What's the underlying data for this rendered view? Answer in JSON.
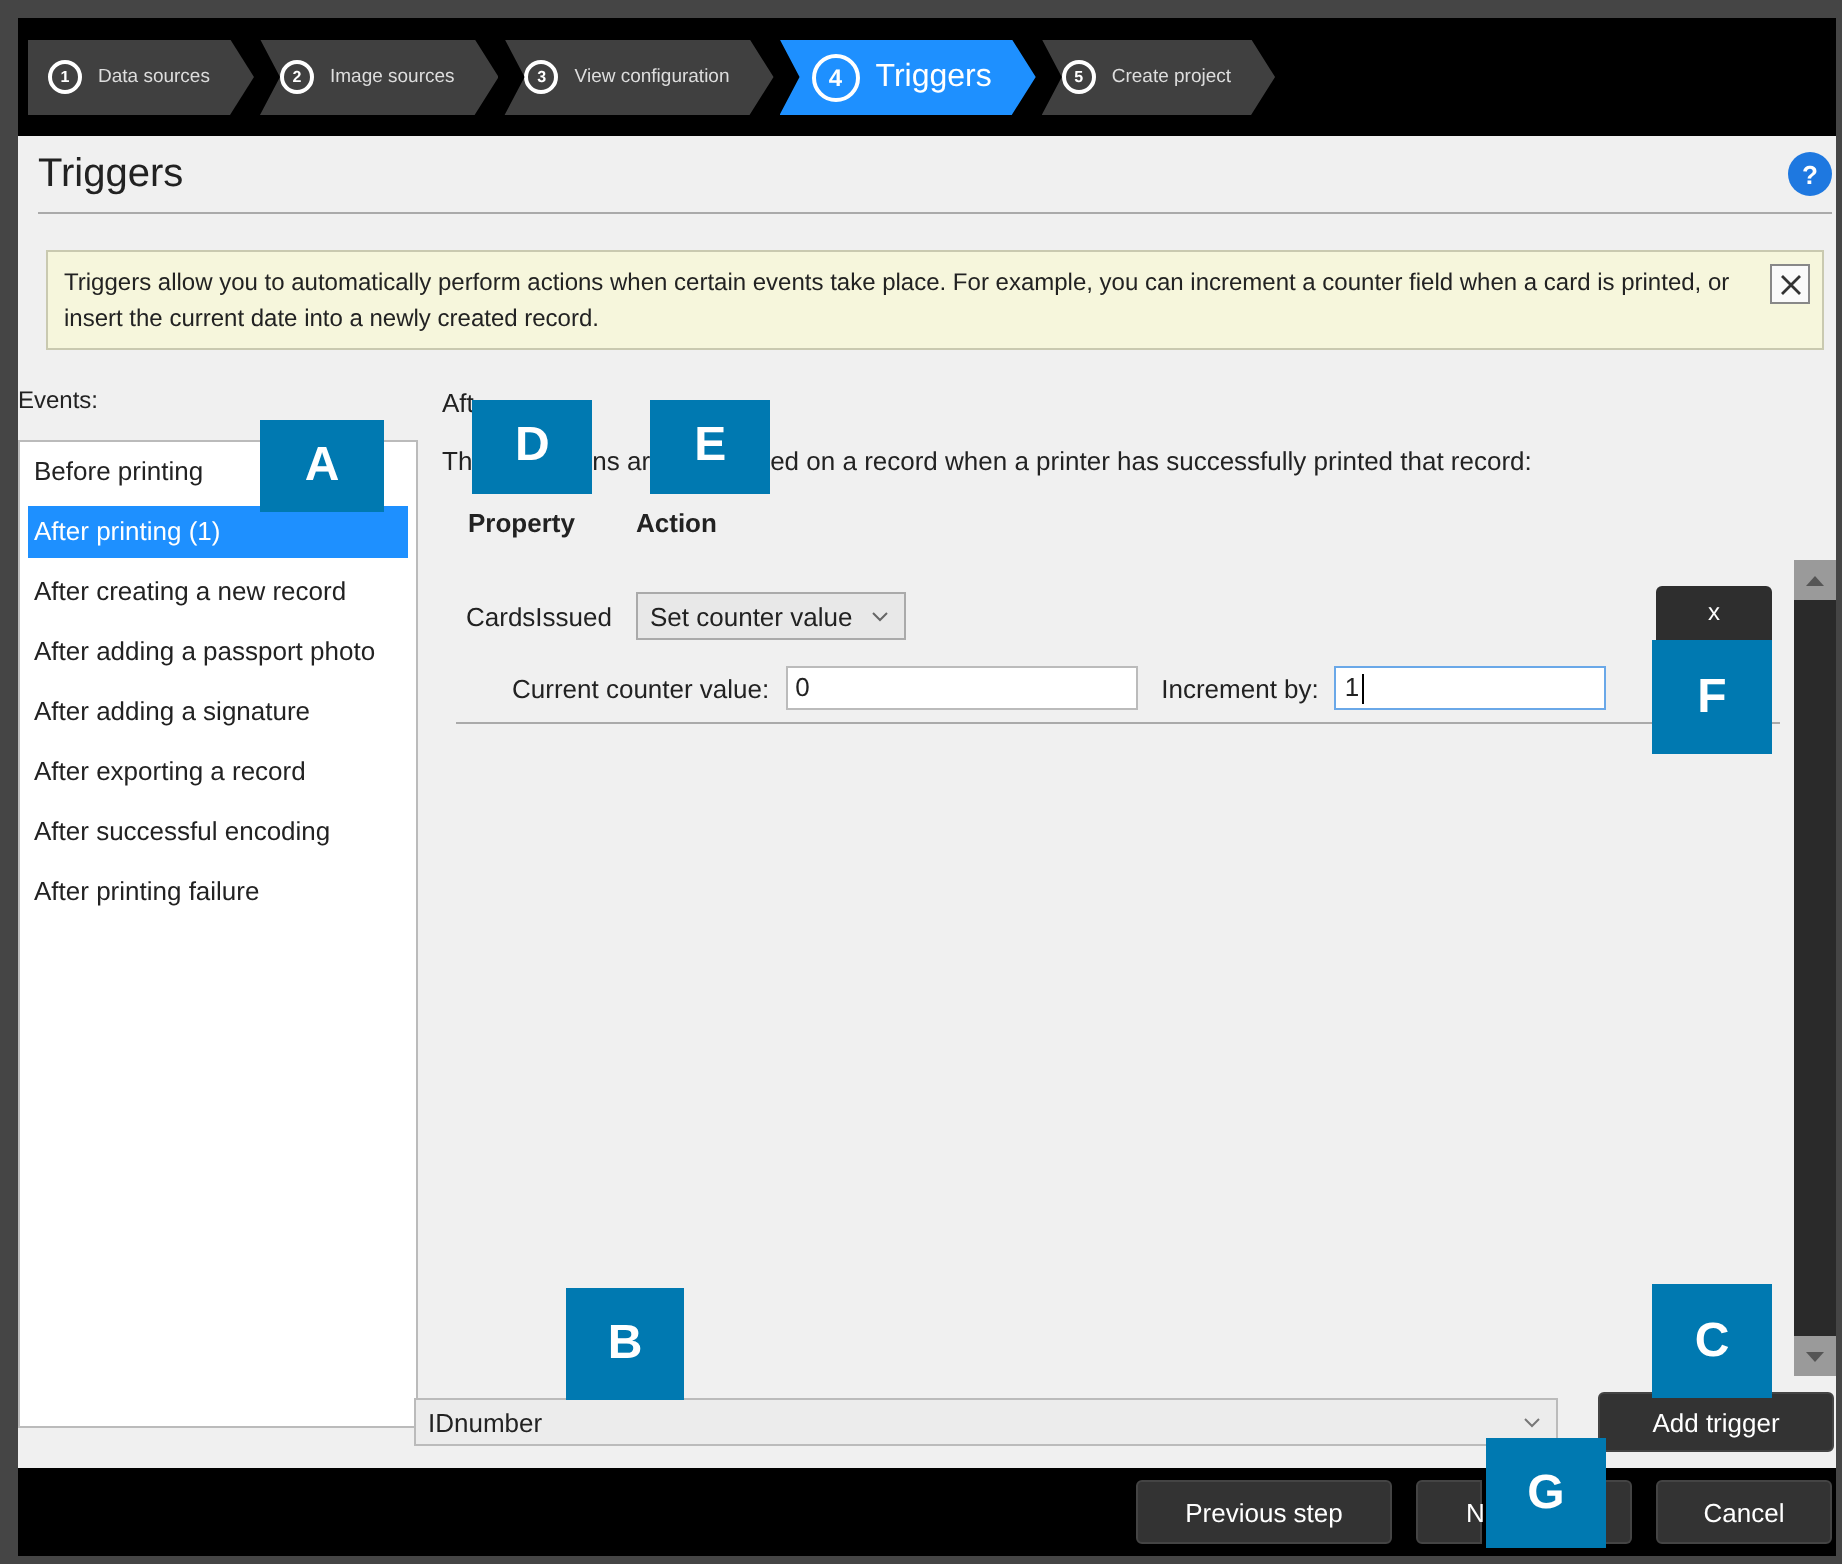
{
  "wizard_steps": [
    {
      "number": "1",
      "label": "Data sources",
      "selected": false
    },
    {
      "number": "2",
      "label": "Image sources",
      "selected": false
    },
    {
      "number": "3",
      "label": "View configuration",
      "selected": false
    },
    {
      "number": "4",
      "label": "Triggers",
      "selected": true
    },
    {
      "number": "5",
      "label": "Create project",
      "selected": false
    }
  ],
  "page": {
    "title": "Triggers",
    "help": "?"
  },
  "info": {
    "text": "Triggers allow you to automatically perform actions when certain events take place. For example, you can increment a counter field when a card is printed, or insert the current date into a newly created record."
  },
  "events": {
    "label": "Events:",
    "items": [
      {
        "label": "Before printing",
        "selected": false
      },
      {
        "label": "After printing  (1)",
        "selected": true
      },
      {
        "label": "After creating a new record",
        "selected": false
      },
      {
        "label": "After adding a passport photo",
        "selected": false
      },
      {
        "label": "After adding a signature",
        "selected": false
      },
      {
        "label": "After exporting a record",
        "selected": false
      },
      {
        "label": "After successful encoding",
        "selected": false
      },
      {
        "label": "After printing failure",
        "selected": false
      }
    ]
  },
  "detail": {
    "heading": "Aft",
    "sentence_parts": [
      "Th",
      "ns ar",
      "ed on a record when a printer has successfully printed that record:"
    ],
    "columns": [
      "Property",
      "Action"
    ],
    "triggers": [
      {
        "property": "CardsIssued",
        "action": "Set counter value",
        "delete": "x",
        "fields": [
          {
            "label": "Current counter value:",
            "value": "0",
            "focused": false
          },
          {
            "label": "Increment by:",
            "value": "1",
            "focused": true
          }
        ]
      }
    ]
  },
  "property_select": {
    "value": "IDnumber"
  },
  "add_button": "Add trigger",
  "footer_buttons": [
    "Previous step",
    "N",
    "Cancel"
  ],
  "callouts": [
    "A",
    "B",
    "C",
    "D",
    "E",
    "F",
    "G"
  ]
}
